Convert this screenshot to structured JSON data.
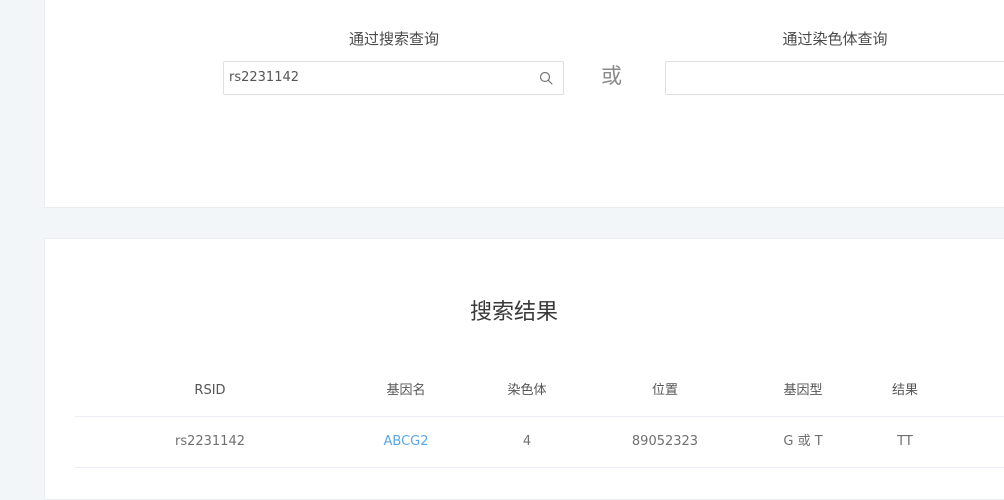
{
  "search": {
    "label": "通过搜索查询",
    "input_value": "rs2231142",
    "placeholder": "",
    "or_text": "或",
    "chrom_label": "通过染色体查询",
    "chrom_selected": ""
  },
  "results": {
    "title": "搜索结果",
    "columns": [
      "RSID",
      "基因名",
      "染色体",
      "位置",
      "基因型",
      "结果"
    ],
    "rows": [
      {
        "rsid": "rs2231142",
        "gene": "ABCG2",
        "chromosome": "4",
        "position": "89052323",
        "genotype": "G 或 T",
        "result": "TT"
      }
    ]
  },
  "colors": {
    "link": "#5aa6e6",
    "background": "#f3f6f9",
    "card": "#ffffff"
  }
}
